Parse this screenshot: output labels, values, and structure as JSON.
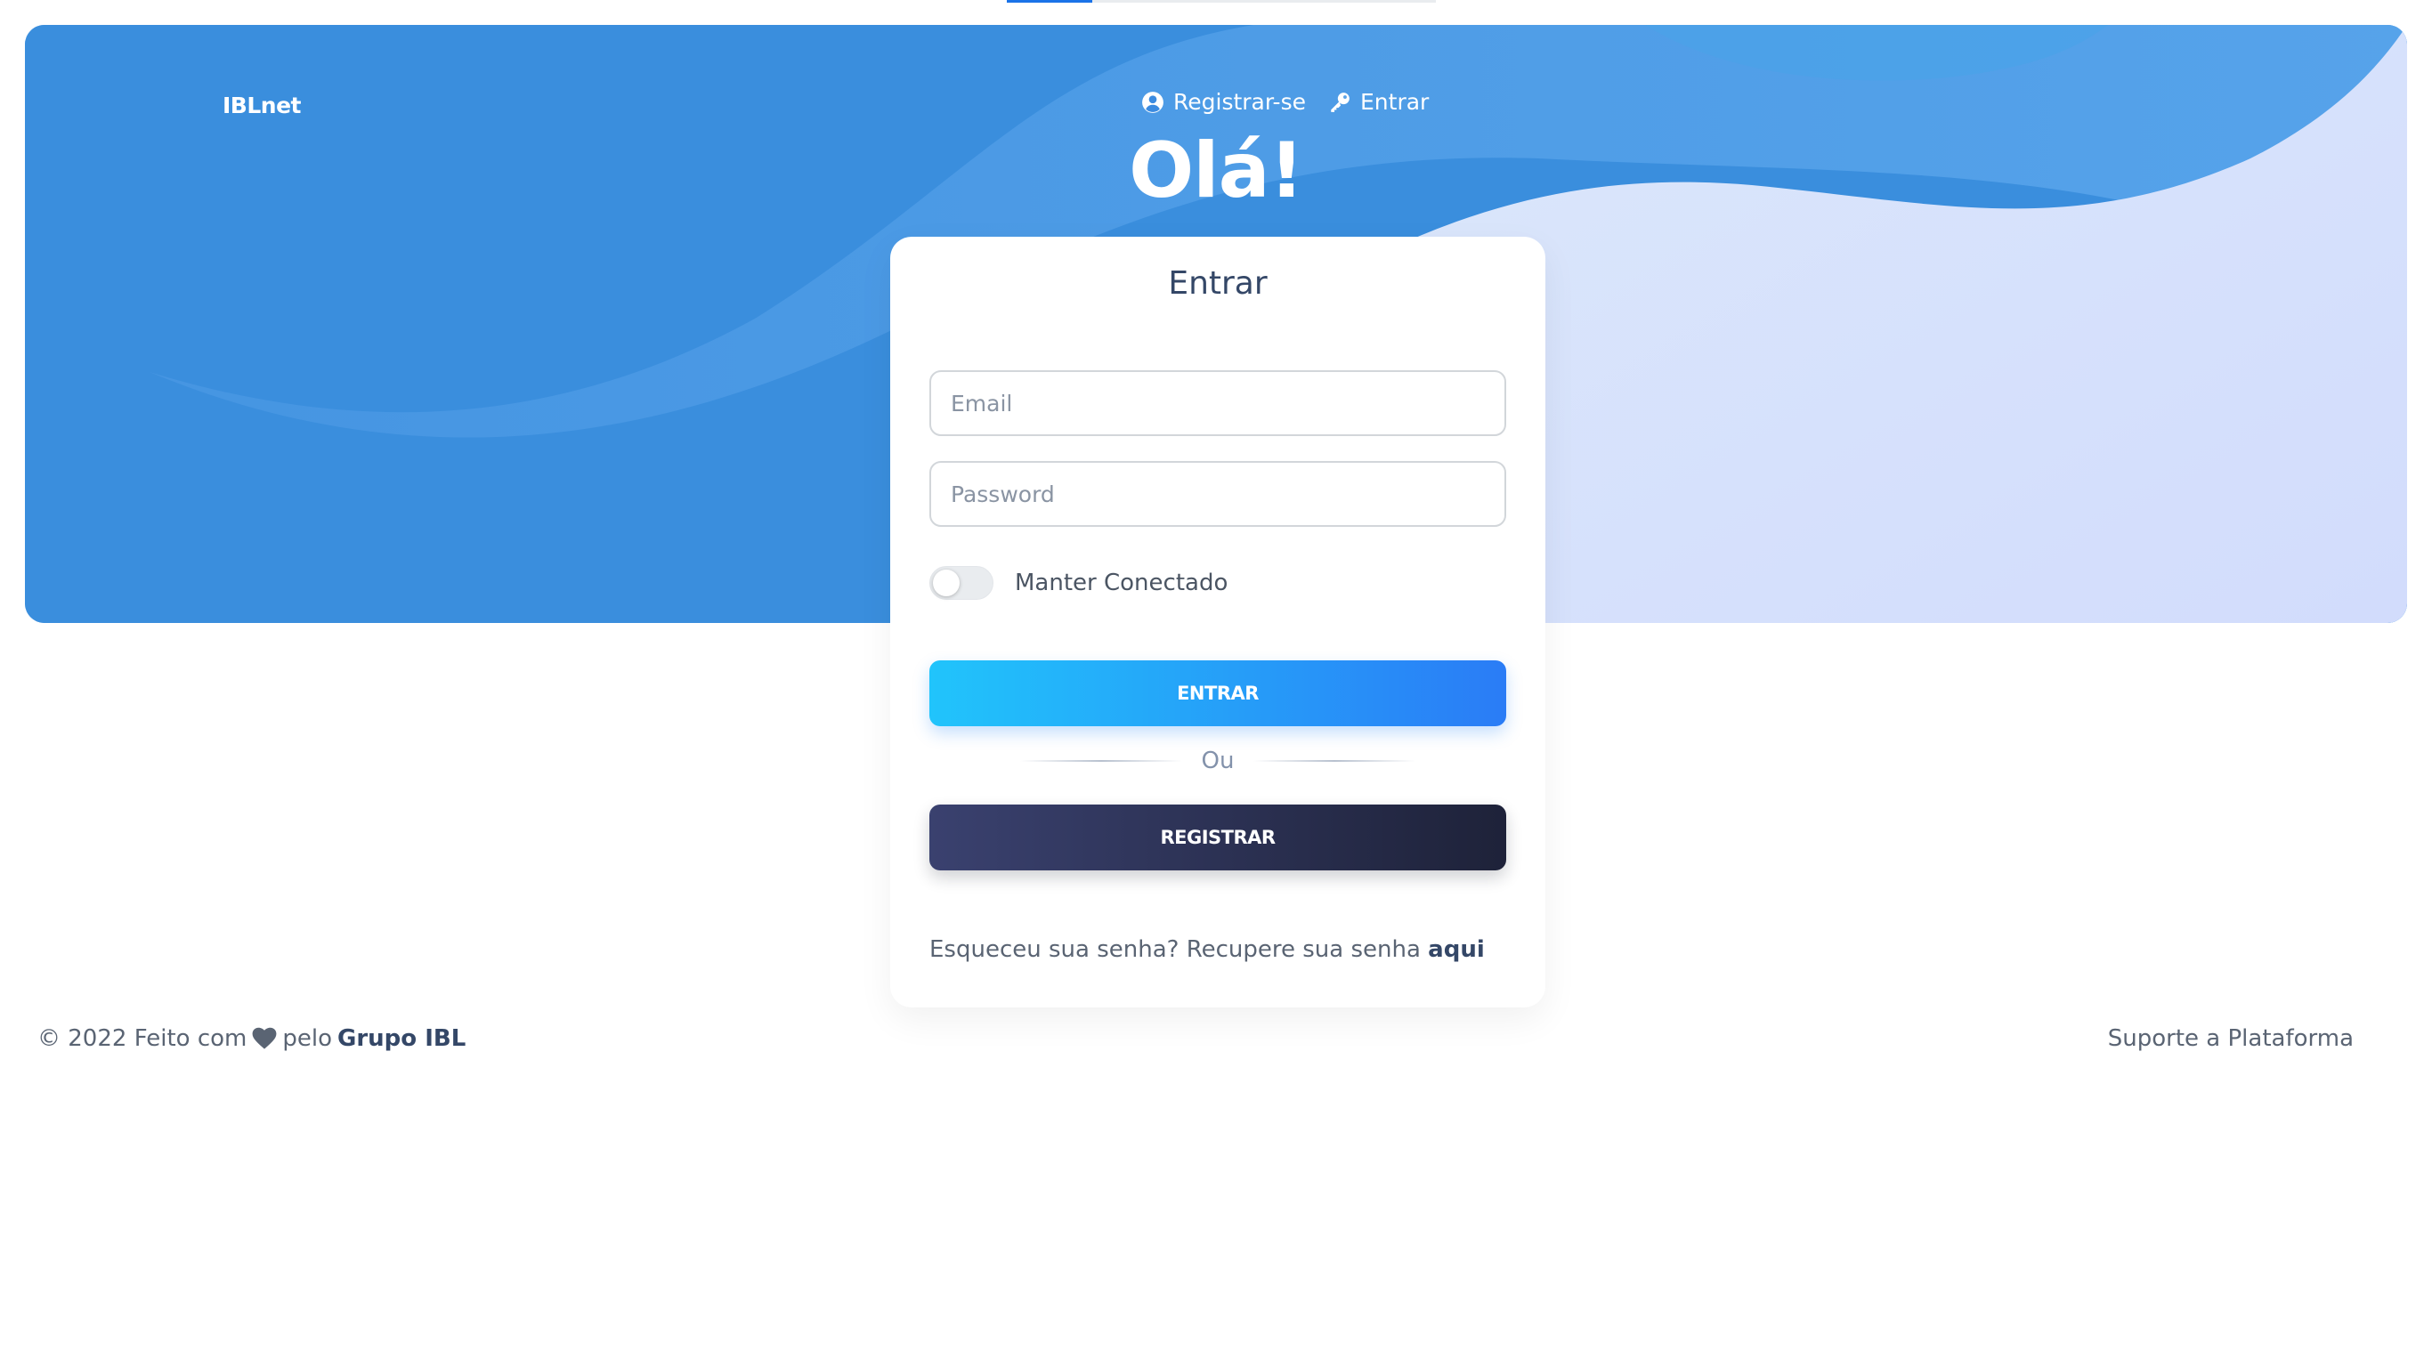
{
  "brand": "IBLnet",
  "nav": {
    "register": {
      "label": "Registrar-se",
      "icon": "user-circle-icon"
    },
    "login": {
      "label": "Entrar",
      "icon": "key-icon"
    }
  },
  "hero": {
    "greeting": "Olá!"
  },
  "login_card": {
    "title": "Entrar",
    "email": {
      "value": "",
      "placeholder": "Email"
    },
    "password": {
      "value": "",
      "placeholder": "Password"
    },
    "remember": {
      "label": "Manter Conectado",
      "checked": false
    },
    "login_button": "ENTRAR",
    "divider_text": "Ou",
    "register_button": "REGISTRAR",
    "forgot_text": "Esqueceu sua senha? Recupere sua senha",
    "forgot_link": "aqui"
  },
  "footer": {
    "copyright": "© 2022 Feito com",
    "heart_icon": "heart-icon",
    "by": "pelo",
    "company": "Grupo IBL",
    "support": "Suporte a Plataforma"
  },
  "colors": {
    "primary_gradient": [
      "#21c4fb",
      "#2a7cf6"
    ],
    "dark_gradient": [
      "#3a416f",
      "#1e2239"
    ],
    "hero_blue": "#3b8be0",
    "text": "#344767"
  }
}
